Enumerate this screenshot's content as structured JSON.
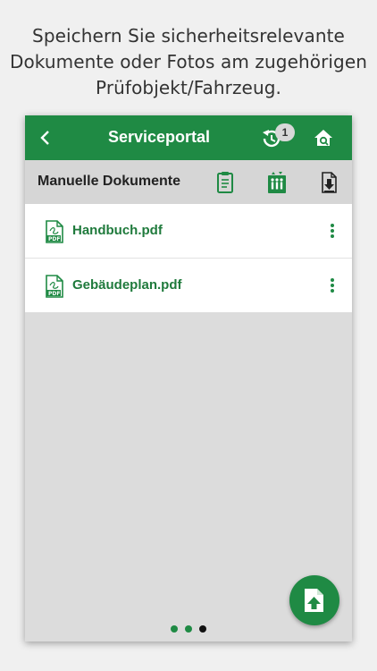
{
  "caption": {
    "line1": "Speichern Sie sicherheitsrelevante",
    "line2": "Dokumente oder Fotos am zugehörigen",
    "line3": "Prüfobjekt/Fahrzeug."
  },
  "appbar": {
    "title": "Serviceportal",
    "sync_badge": "1"
  },
  "subbar": {
    "title": "Manuelle Dokumente"
  },
  "documents": [
    {
      "name": "Handbuch.pdf",
      "icon": "pdf-file-icon"
    },
    {
      "name": "Gebäudeplan.pdf",
      "icon": "pdf-file-icon"
    }
  ],
  "pager": {
    "count": 3,
    "active": 3
  },
  "colors": {
    "brand_green": "#1f8a44",
    "link_green": "#1f7a3c",
    "subbar_bg": "#d6d6d6",
    "content_bg": "#dcdcdc"
  }
}
